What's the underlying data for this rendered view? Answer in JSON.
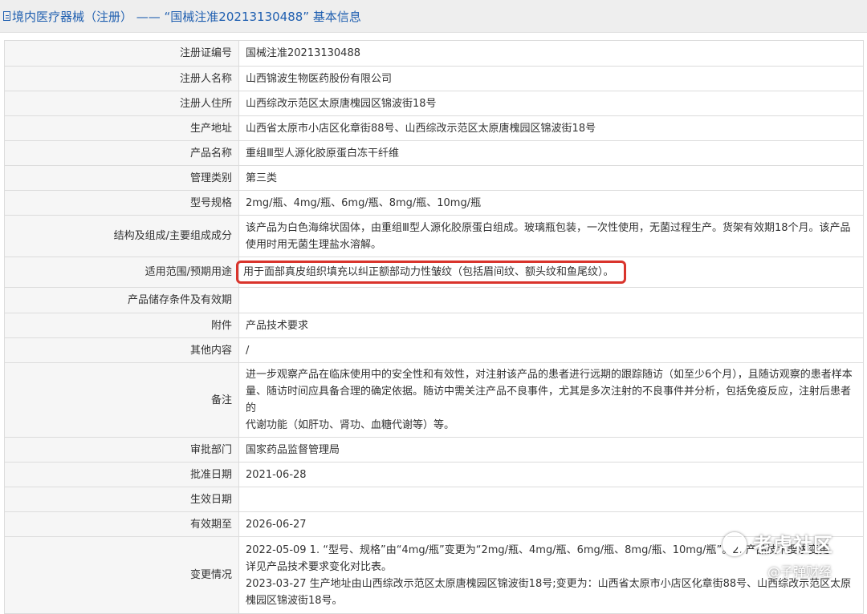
{
  "header": {
    "title": "境内医疗器械（注册） —— “国械注准20213130488” 基本信息"
  },
  "rows": [
    {
      "label": "注册证编号",
      "value": "国械注准20213130488"
    },
    {
      "label": "注册人名称",
      "value": "山西锦波生物医药股份有限公司"
    },
    {
      "label": "注册人住所",
      "value": "山西综改示范区太原唐槐园区锦波街18号"
    },
    {
      "label": "生产地址",
      "value": "山西省太原市小店区化章街88号、山西综改示范区太原唐槐园区锦波街18号"
    },
    {
      "label": "产品名称",
      "value": "重组Ⅲ型人源化胶原蛋白冻干纤维"
    },
    {
      "label": "管理类别",
      "value": "第三类"
    },
    {
      "label": "型号规格",
      "value": "2mg/瓶、4mg/瓶、6mg/瓶、8mg/瓶、10mg/瓶"
    },
    {
      "label": "结构及组成/主要组成成分",
      "value_lines": [
        "该产品为白色海绵状固体，由重组Ⅲ型人源化胶原蛋白组成。玻璃瓶包装，一次性使用，无菌过程生产。货架有效期18个月。该产品",
        "使用时用无菌生理盐水溶解。"
      ]
    },
    {
      "label": "适用范围/预期用途",
      "value": "用于面部真皮组织填充以纠正额部动力性皱纹（包括眉间纹、额头纹和鱼尾纹）。"
    },
    {
      "label": "产品储存条件及有效期",
      "value": ""
    },
    {
      "label": "附件",
      "value": "产品技术要求"
    },
    {
      "label": "其他内容",
      "value": "/"
    },
    {
      "label": "备注",
      "value_lines": [
        "进一步观察产品在临床使用中的安全性和有效性，对注射该产品的患者进行远期的跟踪随访（如至少6个月），且随访观察的患者样本",
        "量、随访时间应具备合理的确定依据。随访中需关注产品不良事件，尤其是多次注射的不良事件并分析，包括免疫反应，注射后患者的",
        "代谢功能（如肝功、肾功、血糖代谢等）等。"
      ]
    },
    {
      "label": "审批部门",
      "value": "国家药品监督管理局"
    },
    {
      "label": "批准日期",
      "value": "2021-06-28"
    },
    {
      "label": "生效日期",
      "value": ""
    },
    {
      "label": "有效期至",
      "value": "2026-06-27"
    },
    {
      "label": "变更情况",
      "value_lines": [
        "2022-05-09 1. “型号、规格”由“4mg/瓶”变更为“2mg/瓶、4mg/瓶、6mg/瓶、8mg/瓶、10mg/瓶”。2. 产品技术要求变更",
        "详见产品技术要求变化对比表。",
        "2023-03-27 生产地址由山西综改示范区太原唐槐园区锦波街18号;变更为：山西省太原市小店区化章街88号、山西综改示范区太原",
        "槐园区锦波街18号。"
      ]
    }
  ],
  "watermark": {
    "brand": "老虎社区",
    "author": "@子弹财经"
  },
  "colors": {
    "title_blue": "#1f5fb0",
    "highlight_red": "#d9342c",
    "label_bg": "#f6f6f6",
    "border": "#dcdcdc"
  }
}
